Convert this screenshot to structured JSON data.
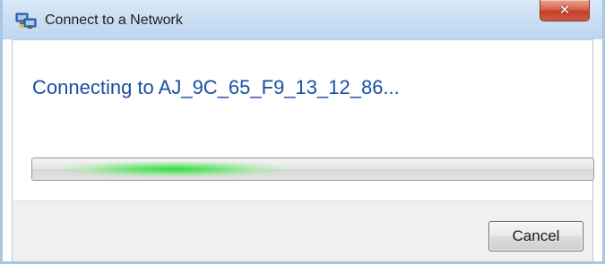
{
  "window": {
    "title": "Connect to a Network",
    "title_icon": "network-icon",
    "close_icon": "close-icon",
    "close_glyph": "✕"
  },
  "main": {
    "status_text": "Connecting to AJ_9C_65_F9_13_12_86..."
  },
  "progress": {
    "type": "marquee",
    "glow_position_fraction": 0.25,
    "glow_color": "#3ada48"
  },
  "footer": {
    "cancel_label": "Cancel"
  },
  "colors": {
    "status_text": "#1a4fa0",
    "titlebar": "#cadff3",
    "close_button": "#c2402a",
    "footer": "#f0f0f0"
  }
}
